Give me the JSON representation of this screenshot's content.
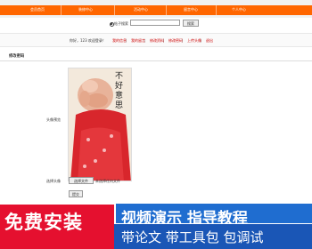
{
  "nav": {
    "items": [
      "会员首页",
      "装修中心",
      "活动中心",
      "留言中心",
      "个人中心"
    ]
  },
  "search": {
    "radio_label": "帖子搜索",
    "button_label": "搜索",
    "input_value": ""
  },
  "userbar": {
    "welcome": "你好，123 欢迎登录！",
    "links": [
      "我的信息",
      "我的留言",
      "修改资料",
      "修改密码",
      "上传头像",
      "退出"
    ]
  },
  "page": {
    "section_title": "修改密码",
    "avatar_label": "头像预览",
    "photo_text": "不好意思",
    "upload_label": "选择头像",
    "file_button": "选择文件",
    "file_status": "未选择任何文件",
    "submit_label": "提交"
  },
  "promo": {
    "left": "免费安装",
    "right_title": "视频演示 指导教程",
    "right_sub": "带论文 带工具包 包调试"
  },
  "colors": {
    "accent": "#ff6600",
    "promo_red": "#e5102f",
    "promo_blue": "#1f6dd0"
  }
}
